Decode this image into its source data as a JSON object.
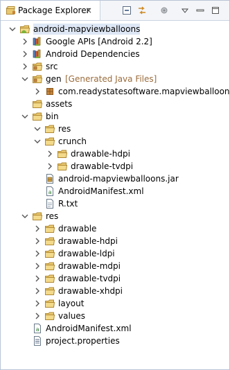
{
  "view": {
    "title": "Package Explorer",
    "close_glyph": "×"
  },
  "toolbar": [
    "collapse-all-icon",
    "link-with-editor-icon",
    "focus-task-icon",
    "view-menu-icon",
    "minimize-icon",
    "maximize-icon"
  ],
  "tree": [
    {
      "label": "android-mapviewballoons",
      "icon": "android-project-icon",
      "expanded": true,
      "selected": true
    },
    {
      "label": "Google APIs [Android 2.2]",
      "icon": "library-icon",
      "expanded": false
    },
    {
      "label": "Android Dependencies",
      "icon": "library-icon",
      "expanded": false
    },
    {
      "label": "src",
      "icon": "source-folder-icon",
      "expanded": false
    },
    {
      "label": "gen",
      "decoration": "[Generated Java Files]",
      "icon": "source-folder-icon",
      "expanded": true
    },
    {
      "label": "com.readystatesoftware.mapviewballoons",
      "icon": "package-icon",
      "expanded": false
    },
    {
      "label": "assets",
      "icon": "folder-icon",
      "expanded": null
    },
    {
      "label": "bin",
      "icon": "folder-icon",
      "expanded": true
    },
    {
      "label": "res",
      "icon": "folder-icon",
      "expanded": true
    },
    {
      "label": "crunch",
      "icon": "folder-icon",
      "expanded": true
    },
    {
      "label": "drawable-hdpi",
      "icon": "folder-icon",
      "expanded": false
    },
    {
      "label": "drawable-tvdpi",
      "icon": "folder-icon",
      "expanded": false
    },
    {
      "label": "android-mapviewballoons.jar",
      "icon": "jar-icon",
      "expanded": null
    },
    {
      "label": "AndroidManifest.xml",
      "icon": "xml-file-icon",
      "expanded": null
    },
    {
      "label": "R.txt",
      "icon": "text-file-icon",
      "expanded": null
    },
    {
      "label": "res",
      "icon": "folder-icon",
      "expanded": true
    },
    {
      "label": "drawable",
      "icon": "folder-icon",
      "expanded": false
    },
    {
      "label": "drawable-hdpi",
      "icon": "folder-icon",
      "expanded": false
    },
    {
      "label": "drawable-ldpi",
      "icon": "folder-icon",
      "expanded": false
    },
    {
      "label": "drawable-mdpi",
      "icon": "folder-icon",
      "expanded": false
    },
    {
      "label": "drawable-tvdpi",
      "icon": "folder-icon",
      "expanded": false
    },
    {
      "label": "drawable-xhdpi",
      "icon": "folder-icon",
      "expanded": false
    },
    {
      "label": "layout",
      "icon": "folder-icon",
      "expanded": false
    },
    {
      "label": "values",
      "icon": "folder-icon",
      "expanded": false
    },
    {
      "label": "AndroidManifest.xml",
      "icon": "xml-file-icon",
      "expanded": null
    },
    {
      "label": "project.properties",
      "icon": "properties-file-icon",
      "expanded": null
    }
  ],
  "colors": {
    "folder": "#e8c870",
    "folder_border": "#b08830",
    "selection": "#dde7f5",
    "decoration": "#9a6b3a",
    "package": "#c8843a",
    "android_green": "#7fb23a"
  }
}
